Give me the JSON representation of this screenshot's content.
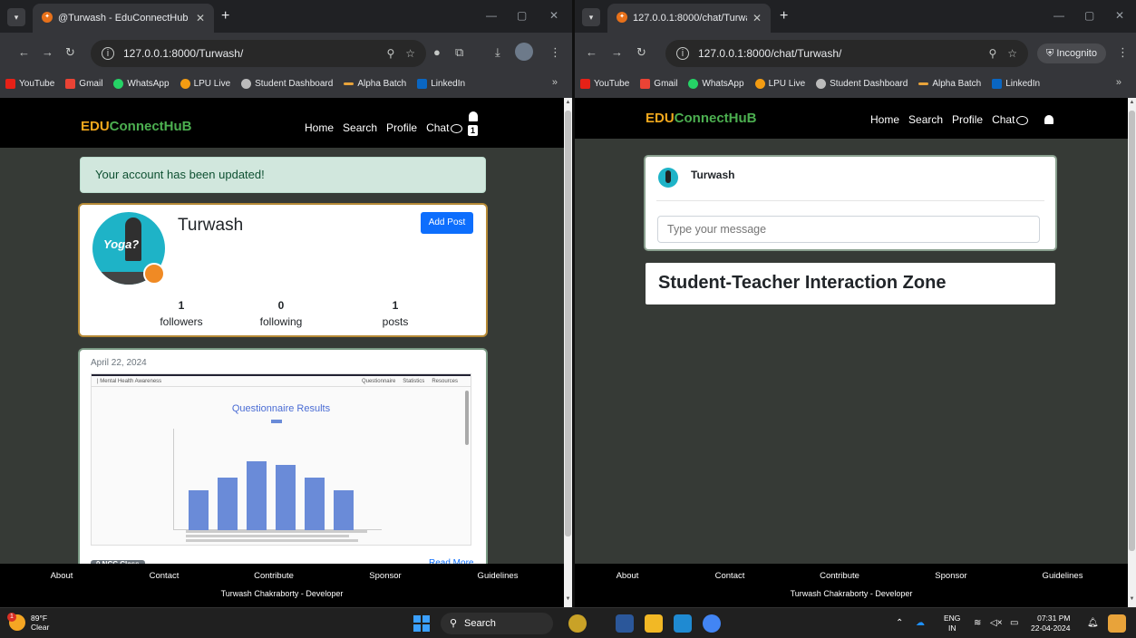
{
  "left_window": {
    "tab_title": "@Turwash - EduConnectHub",
    "url": "127.0.0.1:8000/Turwash/",
    "bookmarks": [
      "YouTube",
      "Gmail",
      "WhatsApp",
      "LPU Live",
      "Student Dashboard",
      "Alpha Batch",
      "LinkedIn"
    ],
    "site": {
      "brand_a": "EDU",
      "brand_b": "ConnectHuB",
      "nav": [
        "Home",
        "Search",
        "Profile",
        "Chat"
      ],
      "notification_count": "1",
      "alert": "Your account has been updated!",
      "profile": {
        "username": "Turwash",
        "add_post": "Add Post",
        "avatar_text": "Yoga?",
        "stats": [
          {
            "value": "1",
            "label": "followers"
          },
          {
            "value": "0",
            "label": "following"
          },
          {
            "value": "1",
            "label": "posts"
          }
        ]
      },
      "post": {
        "date": "April 22, 2024",
        "shot_header": "| Mental Health Awareness",
        "shot_nav": [
          "Questionnaire",
          "Statistics",
          "Resources"
        ],
        "shot_title": "Questionnaire Results",
        "badge": "0 NCC Class",
        "read_more": "Read More"
      }
    }
  },
  "right_window": {
    "tab_title": "127.0.0.1:8000/chat/Turwash/",
    "url": "127.0.0.1:8000/chat/Turwash/",
    "incognito_label": "Incognito",
    "bookmarks": [
      "YouTube",
      "Gmail",
      "WhatsApp",
      "LPU Live",
      "Student Dashboard",
      "Alpha Batch",
      "LinkedIn"
    ],
    "site": {
      "brand_a": "EDU",
      "brand_b": "ConnectHuB",
      "nav": [
        "Home",
        "Search",
        "Profile",
        "Chat"
      ],
      "chat_user": "Turwash",
      "message_placeholder": "Type your message",
      "zone_title": "Student-Teacher Interaction Zone"
    }
  },
  "footer": {
    "links": [
      "About",
      "Contact",
      "Contribute",
      "Sponsor",
      "Guidelines"
    ],
    "credit": "Turwash Chakraborty - Developer"
  },
  "taskbar": {
    "temperature": "89°F",
    "condition": "Clear",
    "weather_badge": "1",
    "search_label": "Search",
    "lang_top": "ENG",
    "lang_bottom": "IN",
    "time": "07:31 PM",
    "date": "22-04-2024"
  },
  "colors": {
    "brand_orange": "#f2a81d",
    "brand_green": "#4caf50",
    "page_bg": "#363a36",
    "add_post_blue": "#0d6efd",
    "alert_bg": "#d1e7dd"
  }
}
